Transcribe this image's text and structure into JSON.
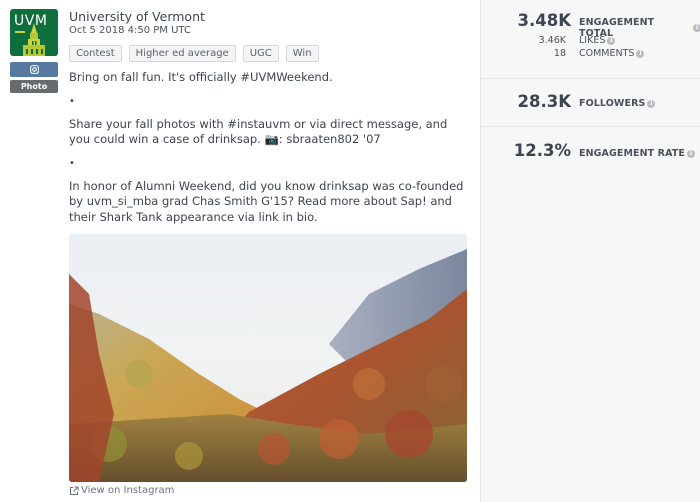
{
  "post": {
    "account_name": "University of Vermont",
    "timestamp": "Oct 5 2018 4:50 PM UTC",
    "logo_text": "UVM",
    "network_icon": "instagram-icon",
    "post_type": "Photo",
    "tags": [
      "Contest",
      "Higher ed average",
      "UGC",
      "Win"
    ],
    "caption": {
      "line1": "Bring on fall fun. It's officially #UVMWeekend.",
      "separator": "•",
      "line2": "Share your fall photos with #instauvm or via direct message, and you could win a case of drinksap. 📷: sbraaten802 '07",
      "line3": "In honor of Alumni Weekend, did you know drinksap was co-founded by uvm_si_mba grad Chas Smith G'15? Read more about Sap! and their Shark Tank appearance via link in bio."
    },
    "image_alt": "Foggy mountain valley with autumn foliage",
    "view_link": "View on Instagram"
  },
  "metrics": {
    "engagement_total": {
      "value": "3.48K",
      "label": "ENGAGEMENT TOTAL"
    },
    "likes": {
      "value": "3.46K",
      "label": "LIKES"
    },
    "comments": {
      "value": "18",
      "label": "COMMENTS"
    },
    "followers": {
      "value": "28.3K",
      "label": "FOLLOWERS"
    },
    "engagement_rate": {
      "value": "12.3%",
      "label": "ENGAGEMENT RATE"
    }
  },
  "colors": {
    "brand_green": "#0e6e3c",
    "instagram_badge": "#557a9f",
    "photo_badge": "#666b6f",
    "sidebar_bg": "#f6f7f7",
    "text": "#3d4450"
  }
}
